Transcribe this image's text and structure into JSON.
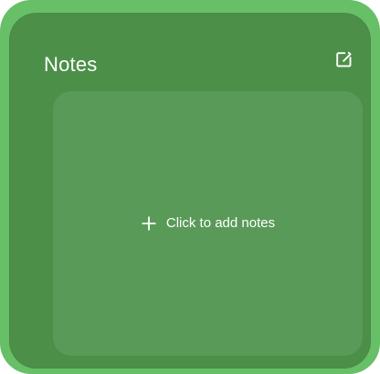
{
  "widget": {
    "title": "Notes",
    "add_label": "Click to add notes",
    "icons": {
      "edit": "edit-square-icon",
      "add": "plus-icon"
    },
    "colors": {
      "outer": "#67bf67",
      "card": "#4c8f49",
      "note_area": "#5a9a58",
      "text": "#ffffff"
    }
  }
}
